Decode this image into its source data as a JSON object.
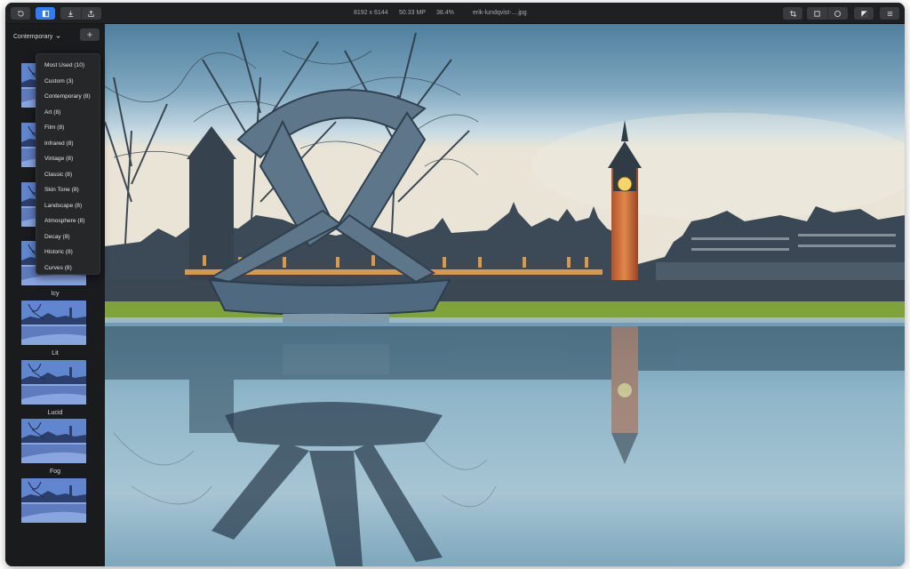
{
  "toolbar": {
    "image_info": {
      "dimensions": "8192 x 6144",
      "megapixels": "50.33 MP",
      "zoom": "38.4%",
      "filename": "erik-lundqvist-....jpg"
    },
    "buttons": [
      {
        "name": "history-button",
        "icon": "history-icon",
        "active": false
      },
      {
        "name": "sidebar-toggle-button",
        "icon": "sidebar-icon",
        "active": true
      },
      {
        "name": "import-button",
        "icon": "download-icon",
        "active": false
      },
      {
        "name": "share-button",
        "icon": "share-icon",
        "active": false
      },
      {
        "name": "crop-button",
        "icon": "crop-icon",
        "active": false
      },
      {
        "name": "rect-mask-button",
        "icon": "square-icon",
        "active": false
      },
      {
        "name": "radial-mask-button",
        "icon": "circle-icon",
        "active": false
      },
      {
        "name": "compare-button",
        "icon": "compare-icon",
        "active": false
      },
      {
        "name": "menu-button",
        "icon": "hamburger-icon",
        "active": false
      }
    ]
  },
  "sidebar": {
    "preset_category": "Contemporary",
    "presets": [
      {
        "label": ""
      },
      {
        "label": ""
      },
      {
        "label": ""
      },
      {
        "label": ""
      },
      {
        "label": "Icy"
      },
      {
        "label": "Lit"
      },
      {
        "label": "Lucid"
      },
      {
        "label": "Fog"
      }
    ]
  },
  "menu": {
    "items": [
      "Most Used (10)",
      "Custom (3)",
      "Contemporary (8)",
      "Art (8)",
      "Film (8)",
      "Infrared (8)",
      "Vintage (8)",
      "Classic (8)",
      "Skin Tone (8)",
      "Landscape (8)",
      "Atmosphere (8)",
      "Decay (8)",
      "Historic (8)",
      "Curves (8)"
    ]
  },
  "colors": {
    "accent": "#2f7cf6",
    "window_bg": "#1a1b1d",
    "toolbar_bg": "#1f2022",
    "menu_bg": "#262729"
  }
}
